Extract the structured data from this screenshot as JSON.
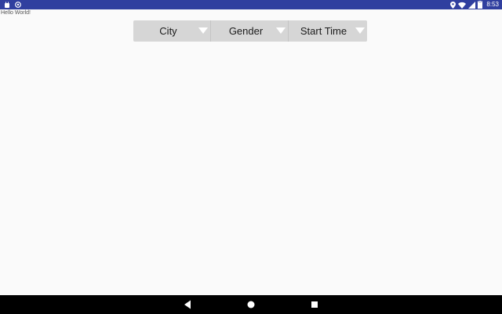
{
  "status_bar": {
    "time": "8:53",
    "left_icons": [
      "android-icon",
      "sync-icon"
    ],
    "right_icons": [
      "location-icon",
      "wifi-icon",
      "signal-icon",
      "battery-icon"
    ],
    "background_color": "#303f9f"
  },
  "content": {
    "hello_text": "Hello World!"
  },
  "filters": {
    "city_label": "City",
    "gender_label": "Gender",
    "start_time_label": "Start Time"
  },
  "navigation": {
    "buttons": [
      "back-icon",
      "home-icon",
      "recents-icon"
    ]
  }
}
